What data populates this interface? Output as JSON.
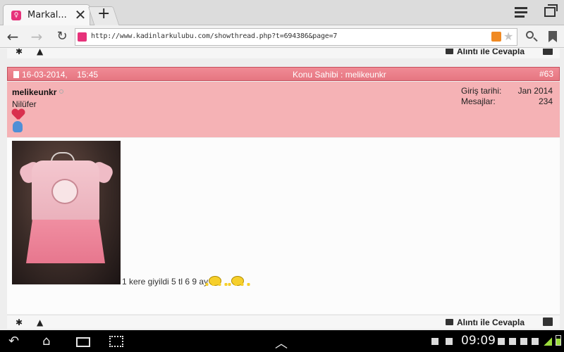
{
  "browser": {
    "tab_title": "Markal...",
    "url": "http://www.kadinlarkulubu.com/showthread.php?t=694386&page=7"
  },
  "post": {
    "date": "16-03-2014,",
    "time": "15:45",
    "owner_label": "Konu Sahibi : melikeunkr",
    "post_number": "#63",
    "username": "melikeunkr",
    "user_title": "Nilüfer",
    "join_label": "Giriş tarihi:",
    "join_value": "Jan 2014",
    "messages_label": "Mesajlar:",
    "messages_value": "234",
    "caption": "1 kere giyildi 5 tl 6 9 ay"
  },
  "actions": {
    "reply_quote": "Alıntı ile Cevapla"
  },
  "system": {
    "clock": "09:09"
  },
  "colors": {
    "post_header": "#e97985",
    "user_panel": "#f5b2b5"
  }
}
